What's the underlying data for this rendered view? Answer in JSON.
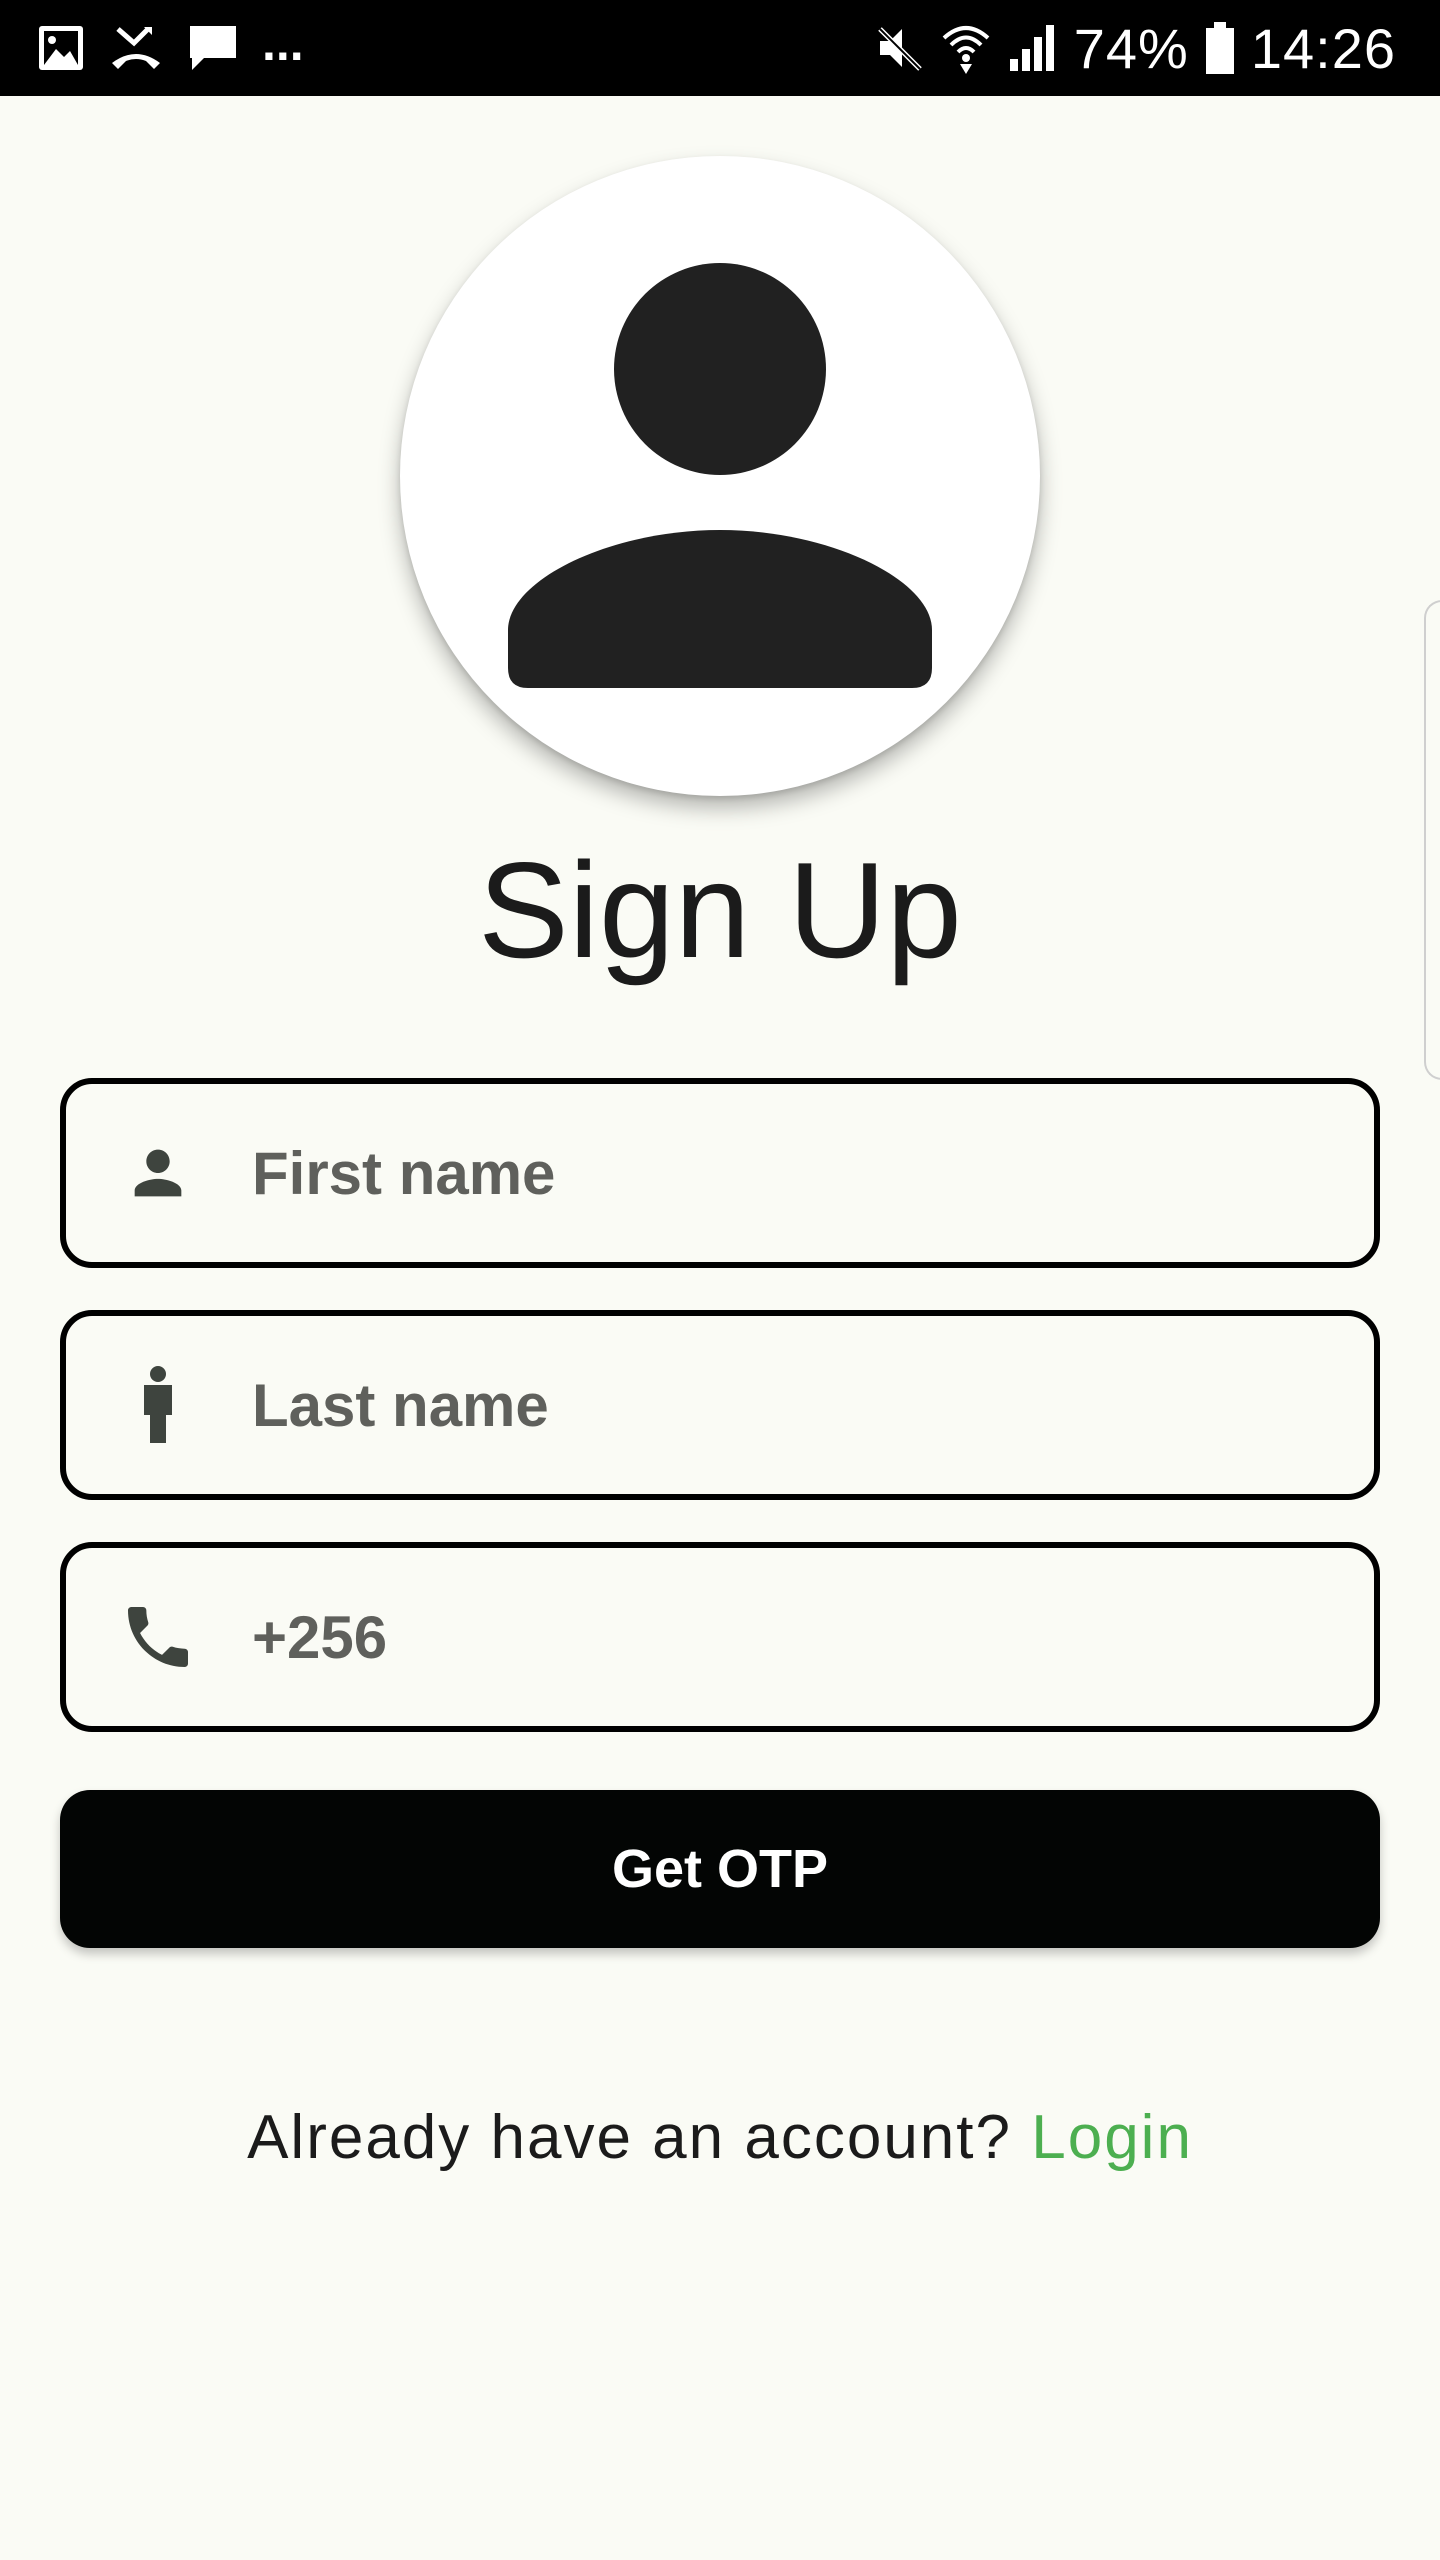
{
  "status_bar": {
    "left_icons": [
      "gallery-icon",
      "missed-call-icon",
      "message-icon"
    ],
    "overflow": "...",
    "right_icons": [
      "mute-icon",
      "wifi-icon",
      "signal-icon",
      "battery-icon"
    ],
    "battery": "74%",
    "time": "14:26"
  },
  "avatar": {
    "icon": "person-avatar-icon"
  },
  "title": "Sign Up",
  "form": {
    "first_name": {
      "icon": "person-icon",
      "placeholder": "First name",
      "value": ""
    },
    "last_name": {
      "icon": "standing-person-icon",
      "placeholder": "Last name",
      "value": ""
    },
    "phone": {
      "icon": "phone-icon",
      "placeholder": "+256",
      "value": ""
    }
  },
  "button": {
    "label": "Get OTP"
  },
  "footer": {
    "prompt": "Already have an account? ",
    "link": "Login"
  },
  "colors": {
    "background": "#fafbf5",
    "primary": "#030504",
    "link": "#4caf50",
    "text": "#1b1b1b",
    "placeholder": "#5f605c"
  }
}
